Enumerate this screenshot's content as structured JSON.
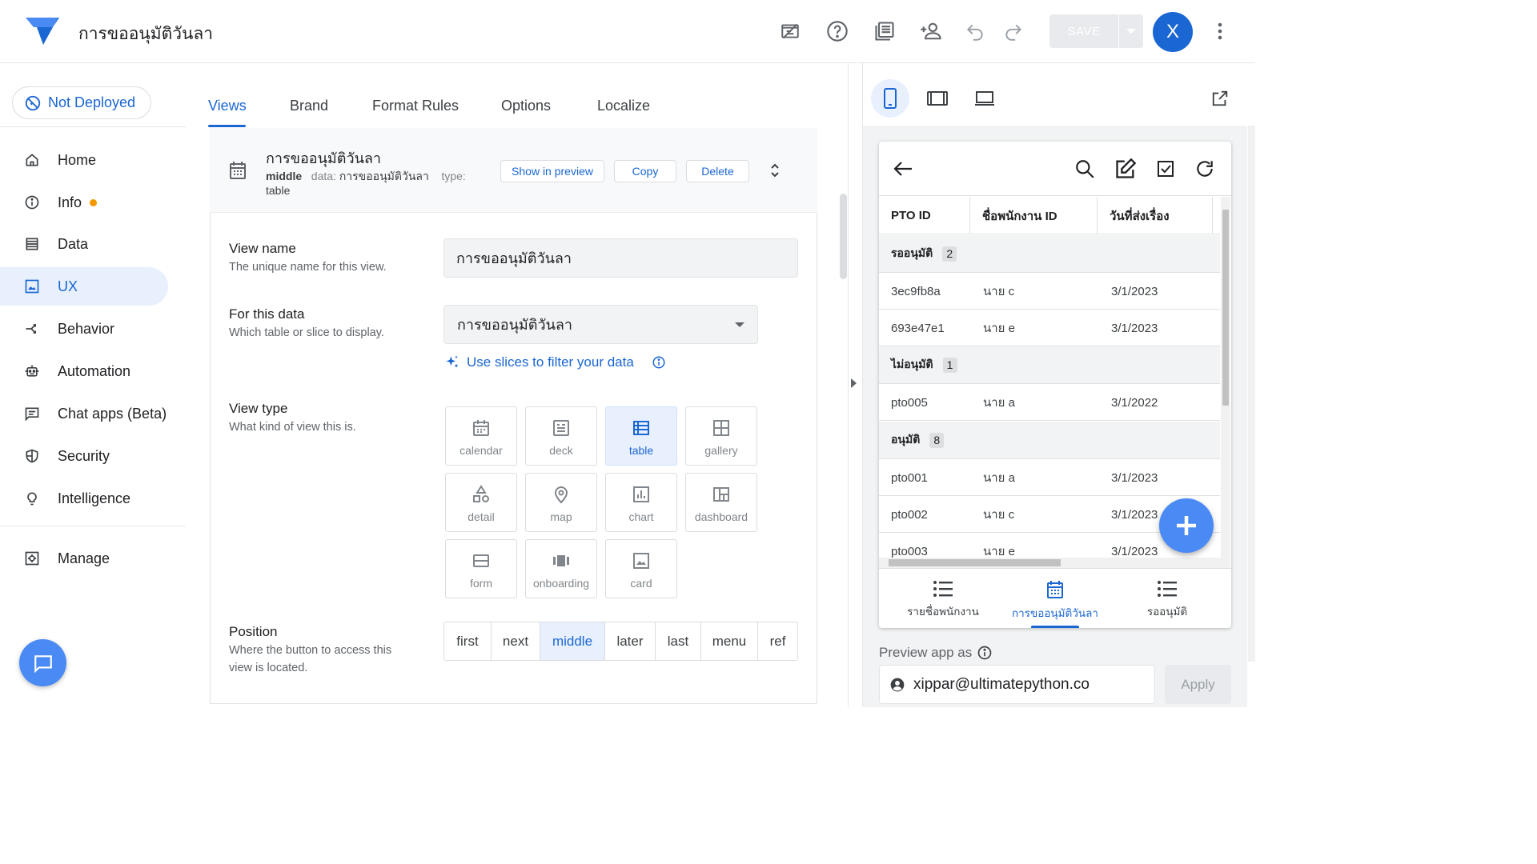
{
  "header": {
    "app_title": "การขออนุมัติวันลา",
    "save_label": "SAVE",
    "avatar_letter": "X",
    "icons": [
      "preview-off-icon",
      "help-icon",
      "docs-icon",
      "add-person-icon",
      "undo-icon",
      "redo-icon"
    ]
  },
  "sidebar": {
    "deploy_status": "Not Deployed",
    "items": [
      {
        "label": "Home",
        "icon": "home-icon"
      },
      {
        "label": "Info",
        "icon": "info-icon"
      },
      {
        "label": "Data",
        "icon": "data-icon"
      },
      {
        "label": "UX",
        "icon": "ux-icon",
        "active": true
      },
      {
        "label": "Behavior",
        "icon": "behavior-icon"
      },
      {
        "label": "Automation",
        "icon": "automation-icon"
      },
      {
        "label": "Chat apps (Beta)",
        "icon": "chat-icon"
      },
      {
        "label": "Security",
        "icon": "shield-icon"
      },
      {
        "label": "Intelligence",
        "icon": "bulb-icon"
      },
      {
        "label": "Manage",
        "icon": "manage-icon"
      }
    ]
  },
  "tabs": [
    {
      "label": "Views",
      "active": true
    },
    {
      "label": "Brand"
    },
    {
      "label": "Format Rules"
    },
    {
      "label": "Options"
    },
    {
      "label": "Localize"
    }
  ],
  "view_card": {
    "title": "การขออนุมัติวันลา",
    "position_value": "middle",
    "data_label": "data:",
    "data_value": "การขออนุมัติวันลา",
    "type_label": "type:",
    "type_value": "table",
    "show_in_preview": "Show in preview",
    "copy": "Copy",
    "delete": "Delete"
  },
  "form": {
    "view_name_label": "View name",
    "view_name_help": "The unique name for this view.",
    "view_name_value": "การขออนุมัติวันลา",
    "for_data_label": "For this data",
    "for_data_help": "Which table or slice to display.",
    "for_data_value": "การขออนุมัติวันลา",
    "slices_link": "Use slices to filter your data",
    "view_type_label": "View type",
    "view_type_help": "What kind of view this is.",
    "view_types": [
      "calendar",
      "deck",
      "table",
      "gallery",
      "detail",
      "map",
      "chart",
      "dashboard",
      "form",
      "onboarding",
      "card"
    ],
    "view_type_selected": "table",
    "position_label": "Position",
    "position_help": "Where the button to access this view is located.",
    "positions": [
      "first",
      "next",
      "middle",
      "later",
      "last",
      "menu",
      "ref"
    ],
    "position_selected": "middle"
  },
  "preview": {
    "columns": [
      "PTO ID",
      "ชื่อพนักงาน ID",
      "วันที่ส่งเรื่อง"
    ],
    "groups": [
      {
        "name": "รออนุมัติ",
        "count": "2",
        "rows": [
          [
            "3ec9fb8a",
            "นาย c",
            "3/1/2023"
          ],
          [
            "693e47e1",
            "นาย e",
            "3/1/2023"
          ]
        ]
      },
      {
        "name": "ไม่อนุมัติ",
        "count": "1",
        "rows": [
          [
            "pto005",
            "นาย a",
            "3/1/2022"
          ]
        ]
      },
      {
        "name": "อนุมัติ",
        "count": "8",
        "rows": [
          [
            "pto001",
            "นาย a",
            "3/1/2023"
          ],
          [
            "pto002",
            "นาย c",
            "3/1/2023"
          ],
          [
            "pto003",
            "นาย e",
            "3/1/2023"
          ]
        ]
      }
    ],
    "bottom_nav": [
      {
        "label": "รายชื่อพนักงาน",
        "icon": "list-icon"
      },
      {
        "label": "การขออนุมัติวันลา",
        "icon": "calendar-icon",
        "active": true
      },
      {
        "label": "รออนุมัติ",
        "icon": "list-icon"
      }
    ],
    "preview_as_label": "Preview app as",
    "user_email": "xippar@ultimatepython.co",
    "apply_label": "Apply"
  },
  "colors": {
    "accent": "#1a66d2",
    "fab": "#4a8af4",
    "active_bg": "#e8f0fe",
    "info_dot": "#f29900"
  }
}
